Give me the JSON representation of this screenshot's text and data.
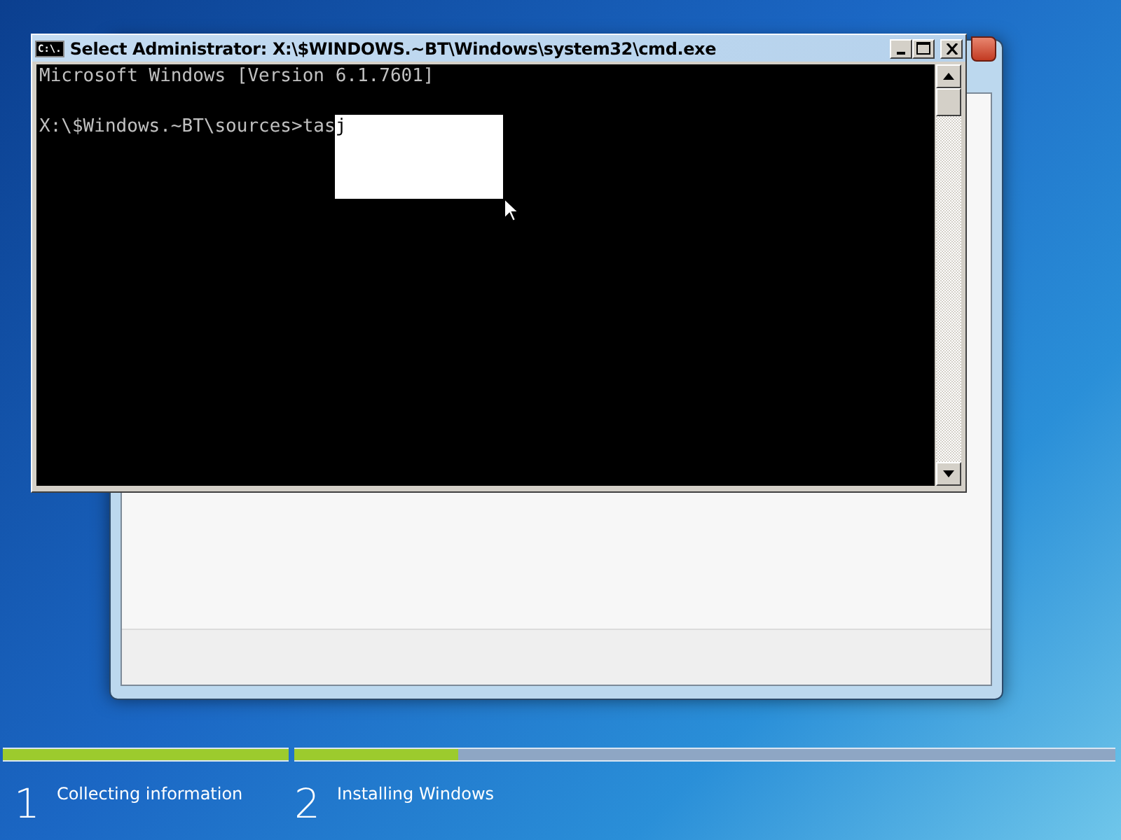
{
  "cmd_window": {
    "title": "Select Administrator: X:\\$WINDOWS.~BT\\Windows\\system32\\cmd.exe",
    "icon_text": "C:\\.",
    "lines": [
      {
        "text": "Microsoft Windows [Version 6.1.7601]"
      }
    ],
    "prompt": {
      "text": "X:\\$Windows.~BT\\sources>tas",
      "selected_text": "j"
    }
  },
  "setup_steps": [
    {
      "number": "1",
      "label": "Collecting information",
      "level": 1
    },
    {
      "number": "2",
      "label": "Installing Windows",
      "level": 0.2
    }
  ]
}
